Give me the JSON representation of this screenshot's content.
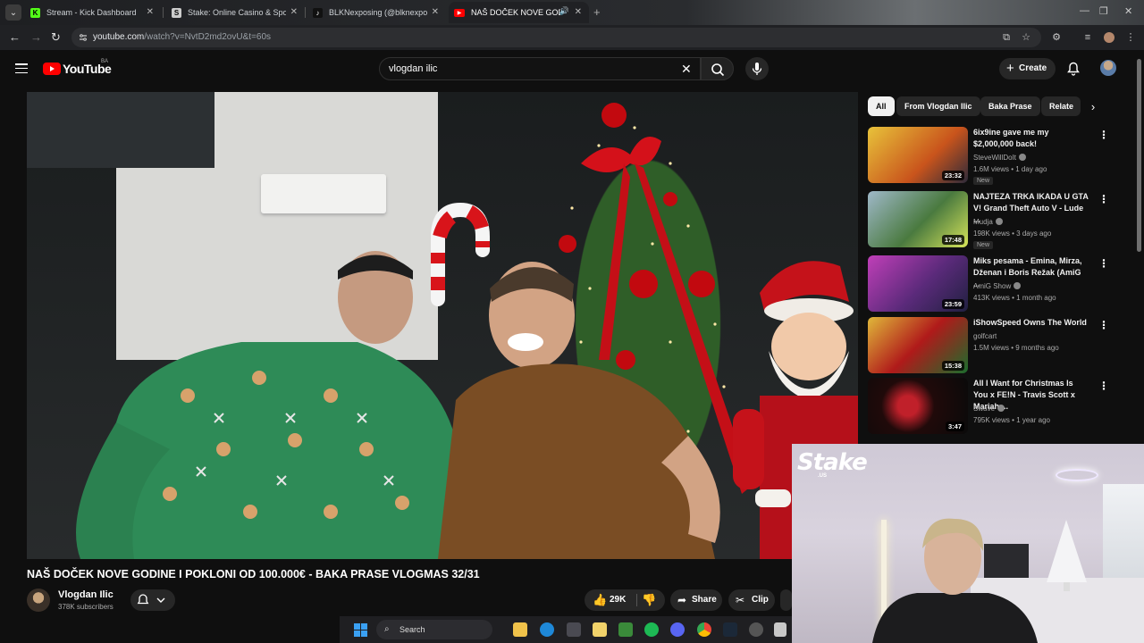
{
  "browser": {
    "tabs": [
      {
        "title": "Stream - Kick Dashboard",
        "favicon": "kick-icon",
        "color": "#53fc18"
      },
      {
        "title": "Stake: Online Casino & Sports",
        "favicon": "stake-icon",
        "color": "#cccccc"
      },
      {
        "title": "BLKNexposing (@blknexposing)",
        "favicon": "tiktok-icon",
        "color": "#ffffff"
      },
      {
        "title": "NAŠ DOČEK NOVE GODINE",
        "favicon": "youtube-icon",
        "color": "#ff0000",
        "active": true
      }
    ],
    "url_host": "youtube.com",
    "url_path": "/watch?v=NvtD2md2ovU&t=60s"
  },
  "youtube": {
    "logo_text": "YouTube",
    "country_code": "BA",
    "search_query": "vlogdan ilic",
    "create_label": "Create"
  },
  "video": {
    "title": "NAŠ DOČEK NOVE GODINE I POKLONI OD 100.000€ - BAKA PRASE VLOGMAS 32/31",
    "channel": "Vlogdan Ilic",
    "subscribers": "378K subscribers",
    "likes": "29K",
    "share_label": "Share",
    "clip_label": "Clip"
  },
  "chips": [
    "All",
    "From Vlogdan Ilic",
    "Baka Prase",
    "Relate"
  ],
  "recommendations": [
    {
      "title": "6ix9ine gave me my $2,000,000 back!",
      "channel": "SteveWillDoIt",
      "verified": true,
      "meta": "1.6M views • 1 day ago",
      "badge": "New",
      "duration": "23:32"
    },
    {
      "title": "NAJTEZA TRKA IKADA U GTA V! Grand Theft Auto V - Lude ...",
      "channel": "Mudja",
      "verified": true,
      "meta": "198K views • 3 days ago",
      "badge": "New",
      "duration": "17:48"
    },
    {
      "title": "Miks pesama - Emina, Mirza, Dženan i Boris Režak (AmiG ...",
      "channel": "AmiG Show",
      "verified": true,
      "meta": "413K views • 1 month ago",
      "badge": "",
      "duration": "23:59"
    },
    {
      "title": "iShowSpeed Owns The World",
      "channel": "golfcart",
      "verified": false,
      "meta": "1.5M views • 9 months ago",
      "badge": "",
      "duration": "15:38"
    },
    {
      "title": "All I Want for Christmas Is You x FE!N - Travis Scott x Mariah ...",
      "channel": "Swave",
      "verified": true,
      "meta": "795K views • 1 year ago",
      "badge": "",
      "duration": "3:47"
    }
  ],
  "overlay": {
    "brand": "Stake",
    "brand_sub": ".US"
  },
  "taskbar": {
    "search_label": "Search"
  }
}
